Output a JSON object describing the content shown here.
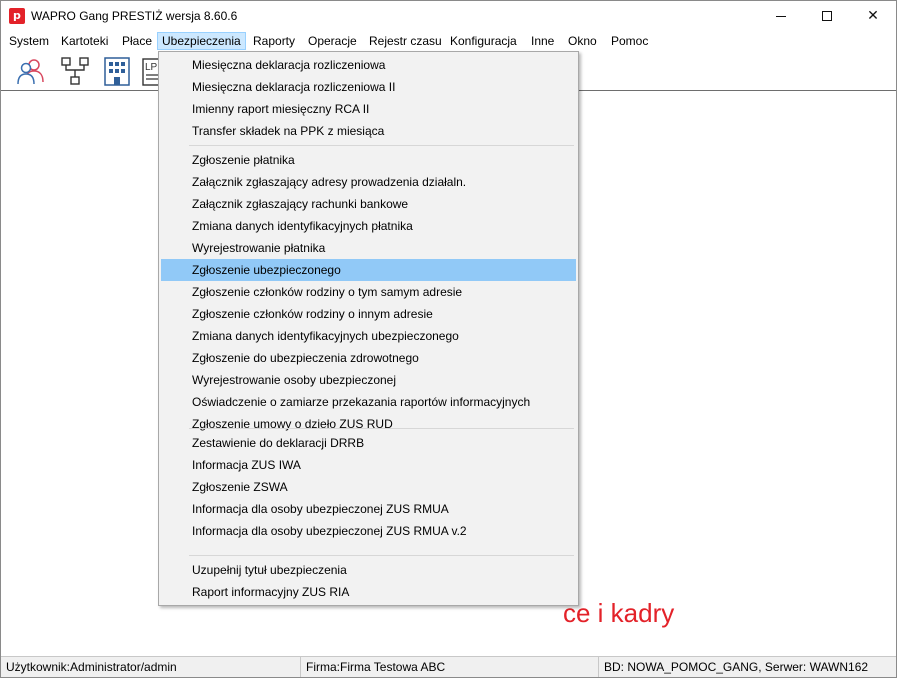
{
  "window": {
    "title": "WAPRO Gang PRESTIŻ wersja 8.60.6",
    "app_icon_letter": "p",
    "close_glyph": "✕"
  },
  "menubar": [
    {
      "label": "System"
    },
    {
      "label": "Kartoteki"
    },
    {
      "label": "Płace"
    },
    {
      "label": "Ubezpieczenia",
      "open": true
    },
    {
      "label": "Raporty"
    },
    {
      "label": "Operacje"
    },
    {
      "label": "Rejestr czasu"
    },
    {
      "label": "Konfiguracja"
    },
    {
      "label": "Inne"
    },
    {
      "label": "Okno"
    },
    {
      "label": "Pomoc"
    }
  ],
  "toolbar": {
    "icons": [
      "users-icon",
      "org-structure-icon",
      "building-icon",
      "list-document-icon"
    ],
    "partial_label": "LP"
  },
  "dropdown": {
    "groups": [
      [
        "Miesięczna deklaracja rozliczeniowa",
        "Miesięczna deklaracja rozliczeniowa II",
        "Imienny raport miesięczny RCA II",
        "Transfer składek na PPK z miesiąca"
      ],
      [
        "Zgłoszenie płatnika",
        "Załącznik zgłaszający adresy prowadzenia działaln.",
        "Załącznik zgłaszający rachunki bankowe",
        "Zmiana danych identyfikacyjnych płatnika",
        "Wyrejestrowanie płatnika",
        "Zgłoszenie ubezpieczonego",
        "Zgłoszenie członków rodziny o tym samym adresie",
        "Zgłoszenie członków rodziny o innym adresie",
        "Zmiana danych identyfikacyjnych ubezpieczonego",
        "Zgłoszenie do ubezpieczenia zdrowotnego",
        "Wyrejestrowanie osoby ubezpieczonej",
        "Oświadczenie o zamiarze przekazania raportów informacyjnych",
        "Zgłoszenie umowy o dzieło ZUS RUD"
      ],
      [
        "Zestawienie do deklaracji DRRB",
        "Informacja ZUS IWA",
        "Zgłoszenie ZSWA",
        "Informacja dla osoby ubezpieczonej ZUS RMUA",
        "Informacja dla osoby ubezpieczonej ZUS RMUA v.2"
      ],
      [
        "Uzupełnij tytuł ubezpieczenia",
        "Raport informacyjny ZUS RIA"
      ]
    ],
    "highlighted": "Zgłoszenie ubezpieczonego"
  },
  "workspace": {
    "brand_text": "ce i kadry"
  },
  "statusbar": {
    "user": "Użytkownik:Administrator/admin",
    "company": "Firma:Firma Testowa ABC",
    "db": "BD: NOWA_POMOC_GANG, Serwer: WAWN162"
  },
  "colors": {
    "brand_red": "#e32229",
    "menu_highlight": "#91c9f7",
    "open_menu_bg": "#cce8ff",
    "dropdown_bg": "#f2f2f2"
  }
}
